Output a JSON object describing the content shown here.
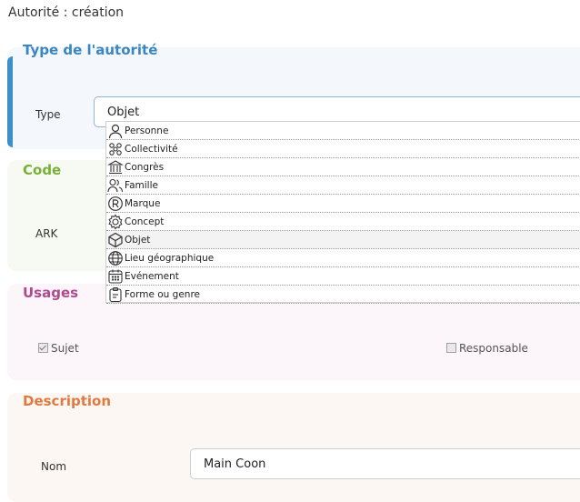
{
  "page": {
    "title": "Autorité : création"
  },
  "sections": {
    "type": {
      "title": "Type de l'autorité",
      "field_label": "Type",
      "selected_value": "Objet",
      "options": [
        {
          "label": "Personne",
          "icon": "person-icon"
        },
        {
          "label": "Collectivité",
          "icon": "collectivity-icon"
        },
        {
          "label": "Congrès",
          "icon": "congress-icon"
        },
        {
          "label": "Famille",
          "icon": "family-icon"
        },
        {
          "label": "Marque",
          "icon": "registered-mark-icon"
        },
        {
          "label": "Concept",
          "icon": "concept-icon"
        },
        {
          "label": "Objet",
          "icon": "object-cube-icon"
        },
        {
          "label": "Lieu géographique",
          "icon": "globe-icon"
        },
        {
          "label": "Evénement",
          "icon": "calendar-icon"
        },
        {
          "label": "Forme ou genre",
          "icon": "clipboard-icon"
        }
      ]
    },
    "code": {
      "title": "Code",
      "field_label": "ARK"
    },
    "usages": {
      "title": "Usages",
      "subject": {
        "label": "Sujet",
        "checked": true
      },
      "responsible": {
        "label": "Responsable",
        "checked": false
      }
    },
    "description": {
      "title": "Description",
      "field_label": "Nom",
      "name_value": "Main Coon"
    }
  },
  "colors": {
    "type_accent": "#3a86c2",
    "code_accent": "#7ab03a",
    "usages_accent": "#b04a90",
    "description_accent": "#e07a40"
  }
}
